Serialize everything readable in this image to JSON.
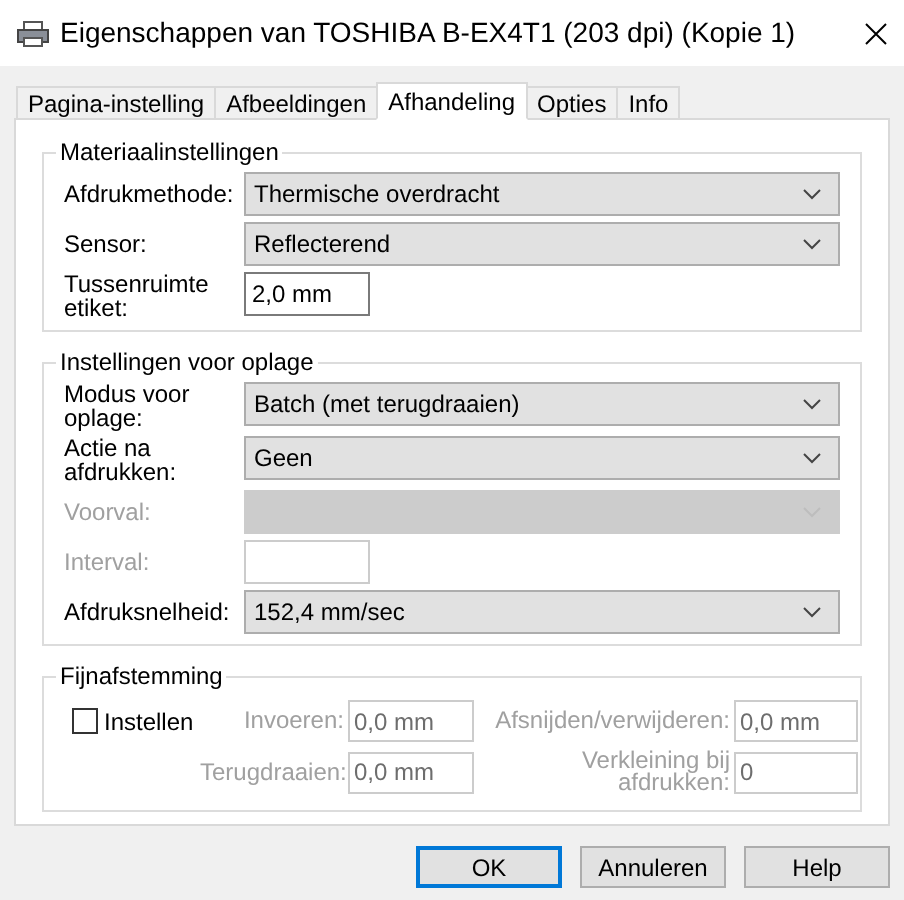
{
  "window": {
    "title": "Eigenschappen van TOSHIBA B-EX4T1 (203 dpi) (Kopie 1)"
  },
  "tabs": [
    {
      "label": "Pagina-instelling",
      "selected": false
    },
    {
      "label": "Afbeeldingen",
      "selected": false
    },
    {
      "label": "Afhandeling",
      "selected": true
    },
    {
      "label": "Opties",
      "selected": false
    },
    {
      "label": "Info",
      "selected": false
    }
  ],
  "groups": [
    {
      "title": "Materiaalinstellingen",
      "fields": [
        {
          "kind": "dropdown",
          "label": "Afdrukmethode:",
          "value": "Thermische overdracht",
          "disabled": false
        },
        {
          "kind": "dropdown",
          "label": "Sensor:",
          "value": "Reflecterend",
          "disabled": false
        },
        {
          "kind": "text",
          "label": "Tussenruimte etiket:",
          "value": "2,0 mm",
          "disabled": false
        }
      ]
    },
    {
      "title": "Instellingen voor oplage",
      "fields": [
        {
          "kind": "dropdown",
          "label": "Modus voor oplage:",
          "value": "Batch (met terugdraaien)",
          "disabled": false
        },
        {
          "kind": "dropdown",
          "label": "Actie na afdrukken:",
          "value": "Geen",
          "disabled": false
        },
        {
          "kind": "dropdown",
          "label": "Voorval:",
          "disabled": true
        },
        {
          "kind": "text",
          "label": "Interval:",
          "disabled": true
        },
        {
          "kind": "dropdown",
          "label": "Afdruksnelheid:",
          "value": "152,4 mm/sec",
          "disabled": false
        }
      ]
    }
  ],
  "fine_tuning": {
    "title": "Fijnafstemming",
    "checkbox": {
      "label": "Instellen",
      "checked": false
    },
    "fields": [
      {
        "label": "Invoeren:",
        "value": "0,0 mm",
        "disabled": true
      },
      {
        "label": "Afsnijden/verwijderen:",
        "value": "0,0 mm",
        "disabled": true
      },
      {
        "label": "Terugdraaien:",
        "value": "0,0 mm",
        "disabled": true
      },
      {
        "label": "Verkleining bij afdrukken:",
        "value": "0",
        "disabled": true
      }
    ]
  },
  "buttons": [
    {
      "label": "OK",
      "default": true
    },
    {
      "label": "Annuleren",
      "default": false
    },
    {
      "label": "Help",
      "default": false
    }
  ]
}
